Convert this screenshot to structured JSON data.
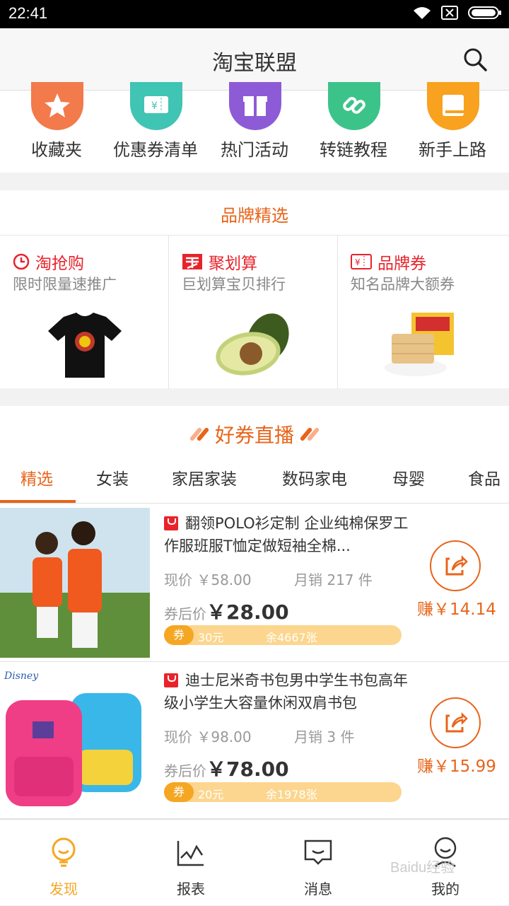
{
  "status": {
    "time": "22:41"
  },
  "header": {
    "title": "淘宝联盟"
  },
  "quicknav": [
    {
      "label": "收藏夹",
      "icon": "star-icon",
      "color": "#f27a4b"
    },
    {
      "label": "优惠券清单",
      "icon": "coupon-icon",
      "color": "#40c4b4"
    },
    {
      "label": "热门活动",
      "icon": "gift-icon",
      "color": "#8e5bd6"
    },
    {
      "label": "转链教程",
      "icon": "link-icon",
      "color": "#3cc38a"
    },
    {
      "label": "新手上路",
      "icon": "book-icon",
      "color": "#f8a21f"
    }
  ],
  "brand": {
    "title": "品牌精选",
    "cells": [
      {
        "name": "淘抢购",
        "sub": "限时限量速推广",
        "icon": "clock-icon",
        "color": "#e8232b"
      },
      {
        "name": "聚划算",
        "sub": "巨划算宝贝排行",
        "icon": "ju-icon",
        "color": "#e8232b"
      },
      {
        "name": "品牌券",
        "sub": "知名品牌大额券",
        "icon": "ticket-icon",
        "color": "#e8232b"
      }
    ]
  },
  "live": {
    "title": "好券直播",
    "tabs": [
      "精选",
      "女装",
      "家居家装",
      "数码家电",
      "母婴",
      "食品"
    ]
  },
  "products": [
    {
      "title": "翻领POLO衫定制 企业纯棉保罗工作服班服T恤定做短袖全棉...",
      "now_label": "现价",
      "now_price": "￥58.00",
      "sales": "月销 217 件",
      "after_label": "券后价",
      "after_price": "￥28.00",
      "coupon_tag": "券",
      "coupon_amount": "30元",
      "coupon_remain": "余4667张",
      "earn": "赚￥14.14"
    },
    {
      "title": "迪士尼米奇书包男中学生书包高年级小学生大容量休闲双肩书包",
      "now_label": "现价",
      "now_price": "￥98.00",
      "sales": "月销 3 件",
      "after_label": "券后价",
      "after_price": "￥78.00",
      "coupon_tag": "券",
      "coupon_amount": "20元",
      "coupon_remain": "余1978张",
      "earn": "赚￥15.99"
    }
  ],
  "bottomnav": [
    {
      "label": "发现",
      "icon": "bulb-icon"
    },
    {
      "label": "报表",
      "icon": "chart-icon"
    },
    {
      "label": "消息",
      "icon": "message-icon"
    },
    {
      "label": "我的",
      "icon": "user-icon"
    }
  ],
  "watermark": "Baidu经验"
}
